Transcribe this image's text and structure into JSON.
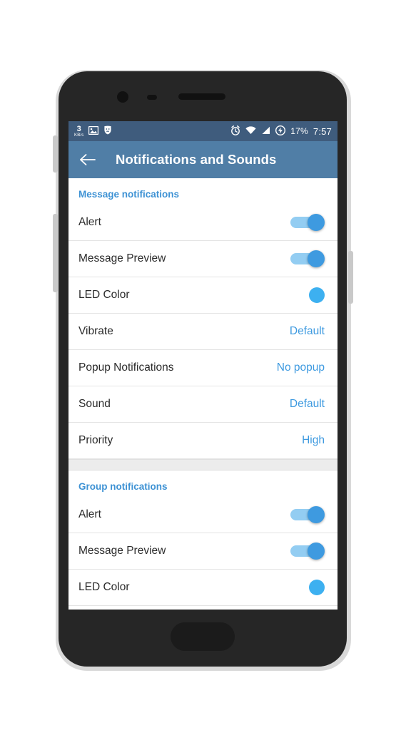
{
  "status_bar": {
    "net_speed_value": "3",
    "net_speed_unit": "KB/s",
    "icons_left": [
      "photo-icon",
      "shield-icon"
    ],
    "icons_right": [
      "alarm-icon",
      "wifi-icon",
      "signal-icon",
      "battery-charging-icon"
    ],
    "battery": "17%",
    "time": "7:57",
    "bg_color": "#3f5c7d"
  },
  "app_bar": {
    "back_icon": "back-arrow-icon",
    "title": "Notifications and Sounds",
    "bg_color": "#507ea6"
  },
  "accent_color": "#3e9ae0",
  "sections": [
    {
      "header": "Message notifications",
      "rows": [
        {
          "label": "Alert",
          "control": "switch",
          "value": "on"
        },
        {
          "label": "Message Preview",
          "control": "switch",
          "value": "on"
        },
        {
          "label": "LED Color",
          "control": "color",
          "value": "#3db0f0"
        },
        {
          "label": "Vibrate",
          "control": "value",
          "value": "Default"
        },
        {
          "label": "Popup Notifications",
          "control": "value",
          "value": "No popup"
        },
        {
          "label": "Sound",
          "control": "value",
          "value": "Default"
        },
        {
          "label": "Priority",
          "control": "value",
          "value": "High"
        }
      ]
    },
    {
      "header": "Group notifications",
      "rows": [
        {
          "label": "Alert",
          "control": "switch",
          "value": "on"
        },
        {
          "label": "Message Preview",
          "control": "switch",
          "value": "on"
        },
        {
          "label": "LED Color",
          "control": "color",
          "value": "#3db0f0"
        }
      ]
    }
  ]
}
